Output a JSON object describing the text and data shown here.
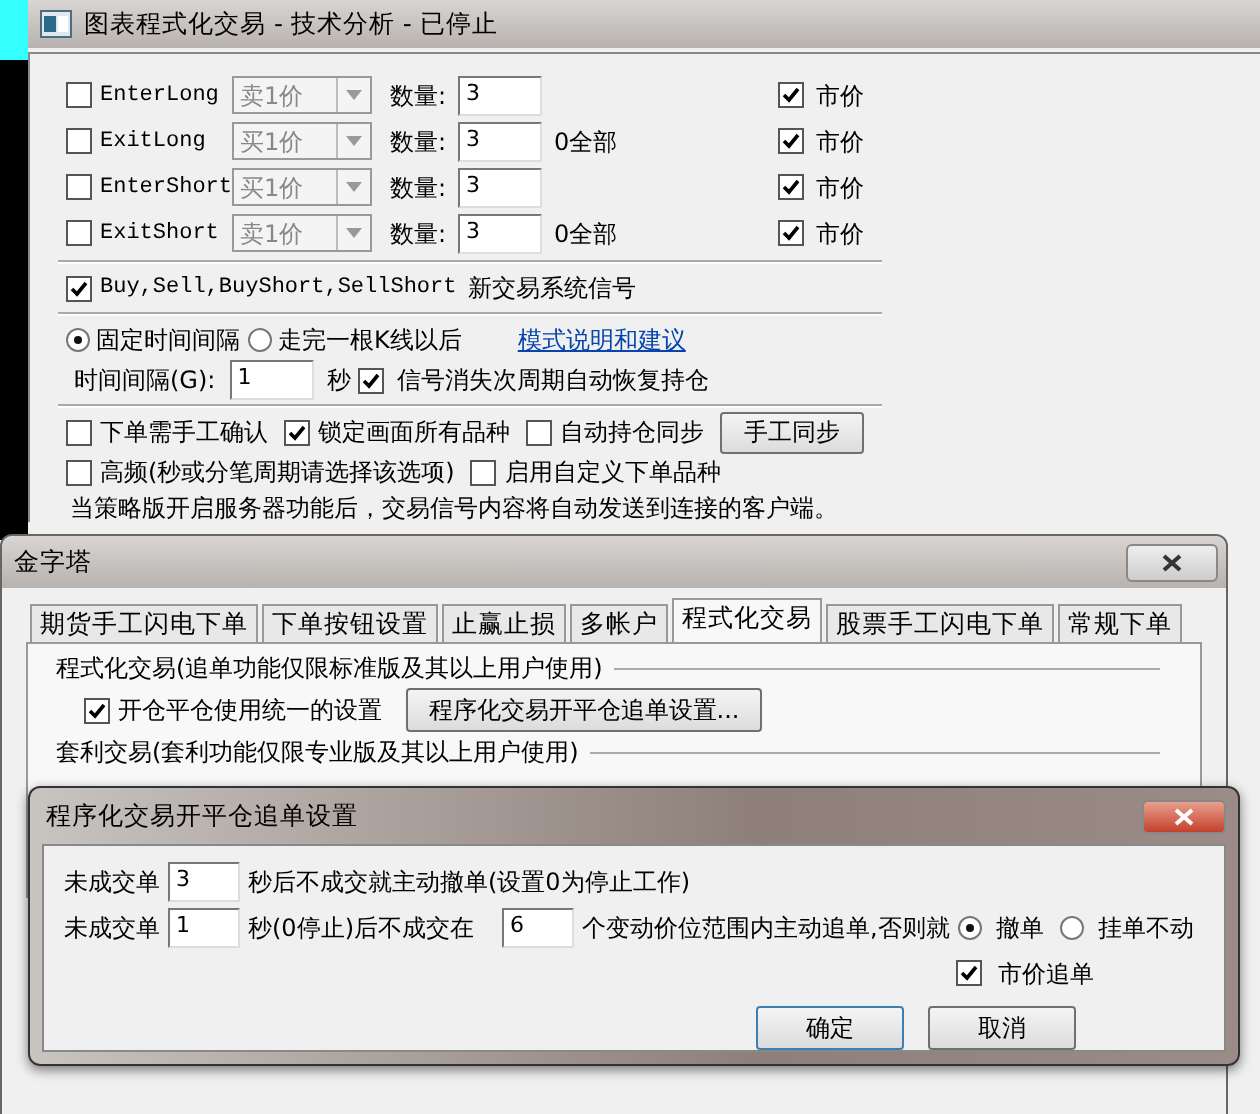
{
  "main_window": {
    "title": "图表程式化交易 - 技术分析 - 已停止",
    "orders": [
      {
        "label": "EnterLong",
        "checked": false,
        "price_type": "卖1价",
        "qty_label": "数量:",
        "qty": "3",
        "market_label": "市价",
        "market_checked": true
      },
      {
        "label": "ExitLong",
        "checked": false,
        "price_type": "买1价",
        "qty_label": "数量:",
        "qty": "3",
        "note": "0全部",
        "market_label": "市价",
        "market_checked": true
      },
      {
        "label": "EnterShort",
        "checked": false,
        "price_type": "买1价",
        "qty_label": "数量:",
        "qty": "3",
        "market_label": "市价",
        "market_checked": true
      },
      {
        "label": "ExitShort",
        "checked": false,
        "price_type": "卖1价",
        "qty_label": "数量:",
        "qty": "3",
        "note": "0全部",
        "market_label": "市价",
        "market_checked": true
      }
    ],
    "signal_option": {
      "label": "Buy,Sell,BuyShort,SellShort",
      "suffix": "新交易系统信号",
      "checked": true
    },
    "interval_modes": [
      {
        "label": "固定时间间隔",
        "selected": true
      },
      {
        "label": "走完一根K线以后",
        "selected": false
      }
    ],
    "help_link": "模式说明和建议",
    "interval_label": "时间间隔(G):",
    "interval_value": "1",
    "interval_unit": "秒",
    "restore": {
      "label": "信号消失次周期自动恢复持仓",
      "checked": true
    },
    "options_row_1": [
      {
        "label": "下单需手工确认",
        "checked": false
      },
      {
        "label": "锁定画面所有品种",
        "checked": true
      },
      {
        "label": "自动持仓同步",
        "checked": false
      }
    ],
    "manual_sync_button": "手工同步",
    "options_row_2": [
      {
        "label": "高频(秒或分笔周期请选择该选项)",
        "checked": false
      },
      {
        "label": "启用自定义下单品种",
        "checked": false
      }
    ],
    "notice": "当策略版开启服务器功能后，交易信号内容将自动发送到连接的客户端。"
  },
  "settings_window": {
    "title": "金字塔",
    "tabs": [
      {
        "label": "期货手工闪电下单",
        "selected": false
      },
      {
        "label": "下单按钮设置",
        "selected": false
      },
      {
        "label": "止赢止损",
        "selected": false
      },
      {
        "label": "多帐户",
        "selected": false
      },
      {
        "label": "程式化交易",
        "selected": true
      },
      {
        "label": "股票手工闪电下单",
        "selected": false
      },
      {
        "label": "常规下单",
        "selected": false
      }
    ],
    "group_1": "程式化交易(追单功能仅限标准版及其以上用户使用)",
    "unified": {
      "label": "开仓平仓使用统一的设置",
      "checked": true
    },
    "chase_settings_button": "程序化交易开平仓追单设置...",
    "group_2": "套利交易(套利功能仅限专业版及其以上用户使用)"
  },
  "chase_dialog": {
    "title": "程序化交易开平仓追单设置",
    "row_1": {
      "prefix": "未成交单",
      "value": "3",
      "suffix": "秒后不成交就主动撤单(设置0为停止工作)"
    },
    "row_2": {
      "prefix": "未成交单",
      "value": "1",
      "middle": "秒(0停止)后不成交在",
      "ticks": "6",
      "suffix": "个变动价位范围内主动追单,否则就"
    },
    "fallback": [
      {
        "label": "撤单",
        "selected": true
      },
      {
        "label": "挂单不动",
        "selected": false
      }
    ],
    "market_chase": {
      "label": "市价追单",
      "checked": true
    },
    "buttons": [
      "确定",
      "取消"
    ]
  }
}
